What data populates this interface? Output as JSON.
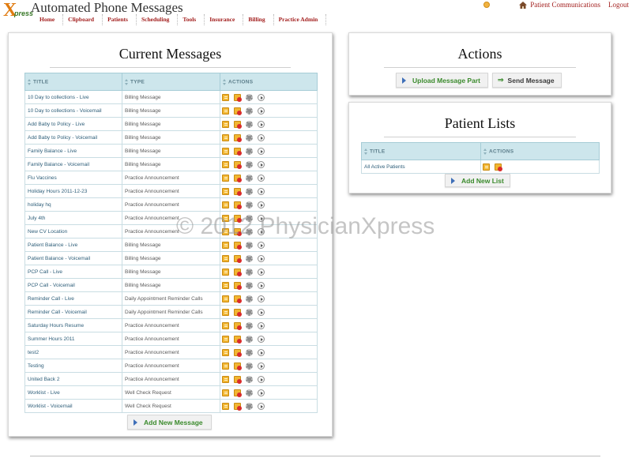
{
  "app": {
    "logo_letter": "X",
    "logo_text": "press",
    "title": "Automated Phone Messages",
    "patient_communications_label": "Patient Communications",
    "logout_label": "Logout"
  },
  "nav": {
    "items": [
      "Home",
      "Clipboard",
      "Patients",
      "Scheduling",
      "Tools",
      "Insurance",
      "Billing",
      "Practice Admin"
    ]
  },
  "messages_panel": {
    "title": "Current Messages",
    "columns": [
      "TITLE",
      "TYPE",
      "ACTIONS"
    ],
    "rows": [
      {
        "title": "10 Day to collections - Live",
        "type": "Billing Message"
      },
      {
        "title": "10 Day to collections - Voicemail",
        "type": "Billing Message"
      },
      {
        "title": "Add Baby to Policy - Live",
        "type": "Billing Message"
      },
      {
        "title": "Add Baby to Policy - Voicemail",
        "type": "Billing Message"
      },
      {
        "title": "Family Balance - Live",
        "type": "Billing Message"
      },
      {
        "title": "Family Balance - Voicemail",
        "type": "Billing Message"
      },
      {
        "title": "Flu Vaccines",
        "type": "Practice Announcement"
      },
      {
        "title": "Holiday Hours 2011-12-23",
        "type": "Practice Announcement"
      },
      {
        "title": "holiday hq",
        "type": "Practice Announcement"
      },
      {
        "title": "July 4th",
        "type": "Practice Announcement"
      },
      {
        "title": "New CV Location",
        "type": "Practice Announcement"
      },
      {
        "title": "Patient Balance - Live",
        "type": "Billing Message"
      },
      {
        "title": "Patient Balance - Voicemail",
        "type": "Billing Message"
      },
      {
        "title": "PCP Call - Live",
        "type": "Billing Message"
      },
      {
        "title": "PCP Call - Voicemail",
        "type": "Billing Message"
      },
      {
        "title": "Reminder Call - Live",
        "type": "Daily Appointment Reminder Calls"
      },
      {
        "title": "Reminder Call - Voicemail",
        "type": "Daily Appointment Reminder Calls"
      },
      {
        "title": "Saturday Hours Resume",
        "type": "Practice Announcement"
      },
      {
        "title": "Summer Hours 2011",
        "type": "Practice Announcement"
      },
      {
        "title": "test2",
        "type": "Practice Announcement"
      },
      {
        "title": "Testing",
        "type": "Practice Announcement"
      },
      {
        "title": "United Back 2",
        "type": "Practice Announcement"
      },
      {
        "title": "Worklist - Live",
        "type": "Well Check Request"
      },
      {
        "title": "Worklist - Voicemail",
        "type": "Well Check Request"
      }
    ],
    "add_button_label": "Add New Message"
  },
  "actions_panel": {
    "title": "Actions",
    "upload_label": "Upload Message Part",
    "send_label": "Send Message"
  },
  "patient_lists_panel": {
    "title": "Patient Lists",
    "columns": [
      "TITLE",
      "ACTIONS"
    ],
    "rows": [
      {
        "title": "All Active Patients"
      }
    ],
    "add_button_label": "Add New List"
  },
  "watermark": "© 2012 PhysicianXpress",
  "colors": {
    "nav_text": "#a3201f",
    "table_header_bg": "#cde6ec",
    "button_text": "#3a8a2c",
    "link_text": "#2f5f7a"
  }
}
